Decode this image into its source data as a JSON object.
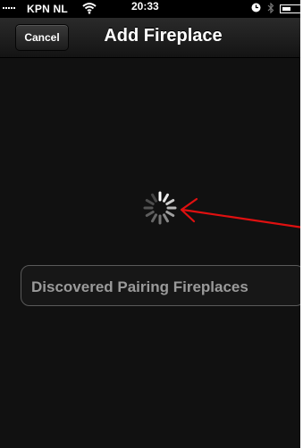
{
  "status_bar": {
    "carrier": "KPN NL",
    "time": "20:33",
    "icons": [
      "signal-icon",
      "wifi-icon",
      "alarm-icon",
      "bluetooth-icon",
      "battery-icon"
    ]
  },
  "nav": {
    "cancel_label": "Cancel",
    "title": "Add Fireplace"
  },
  "loading": {
    "icon": "spinner-icon"
  },
  "annotation": {
    "icon": "red-arrow",
    "color": "#e01010"
  },
  "section": {
    "label": "Discovered Pairing Fireplaces"
  },
  "colors": {
    "background": "#111111",
    "nav_bar": "#1c1c1c",
    "section_border": "#5a5a5a",
    "section_text": "#9a9a9a",
    "arrow": "#e01010"
  }
}
